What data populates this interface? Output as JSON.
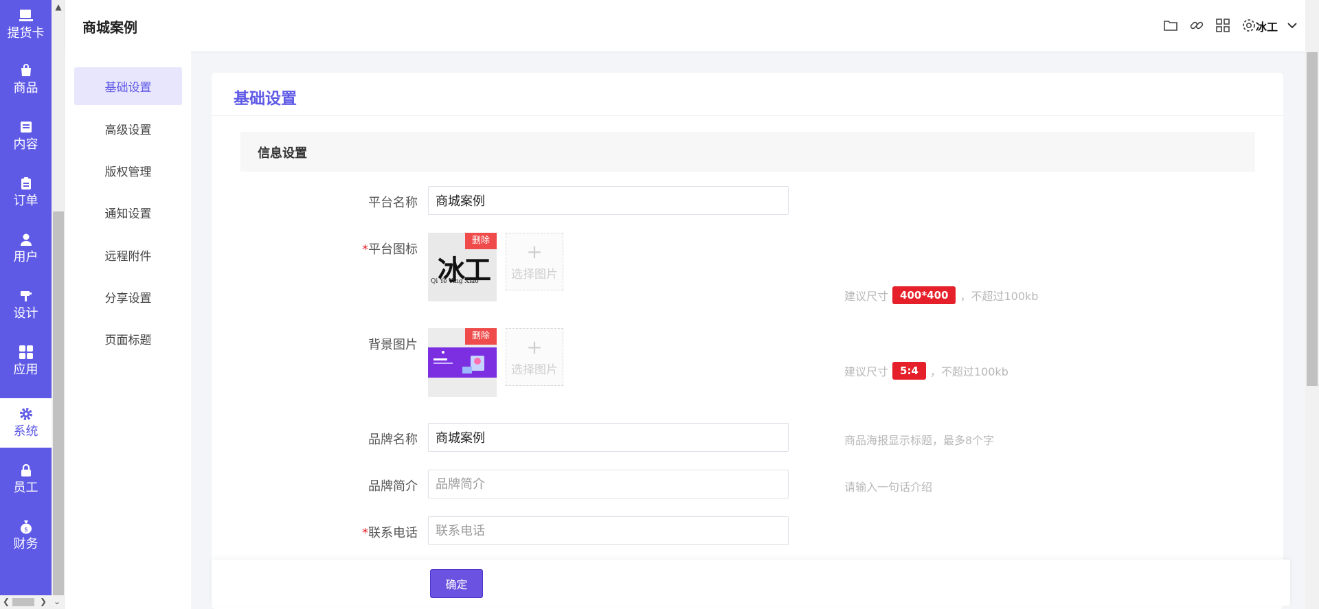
{
  "rail": {
    "items": [
      {
        "label": "提货卡",
        "icon": "card-icon"
      },
      {
        "label": "商品",
        "icon": "bag-icon"
      },
      {
        "label": "内容",
        "icon": "document-icon"
      },
      {
        "label": "订单",
        "icon": "clipboard-icon"
      },
      {
        "label": "用户",
        "icon": "user-icon"
      },
      {
        "label": "设计",
        "icon": "brush-icon"
      },
      {
        "label": "应用",
        "icon": "grid-icon"
      },
      {
        "label": "系统",
        "icon": "gear-icon"
      },
      {
        "label": "员工",
        "icon": "lock-icon"
      },
      {
        "label": "财务",
        "icon": "money-bag-icon"
      }
    ],
    "active_index": 7
  },
  "header": {
    "title": "商城案例",
    "tools": [
      "folder-icon",
      "link-icon",
      "apps-icon",
      "settings-icon"
    ],
    "logo_text": "冰工"
  },
  "subnav": {
    "items": [
      "基础设置",
      "高级设置",
      "版权管理",
      "通知设置",
      "远程附件",
      "分享设置",
      "页面标题"
    ],
    "active_index": 0
  },
  "main": {
    "card_title": "基础设置",
    "section_title": "信息设置",
    "fields": {
      "platform_name": {
        "label": "平台名称",
        "value": "商城案例",
        "required": false
      },
      "platform_icon": {
        "label": "平台图标",
        "required": true,
        "delete": "删除",
        "pick": "选择图片",
        "logo_caption": "Qi Ye Ying Xiao",
        "logo_glyph": "冰工",
        "hint_pre": "建议尺寸",
        "hint_badge": "400*400",
        "hint_post": "，不超过100kb"
      },
      "background_image": {
        "label": "背景图片",
        "required": false,
        "delete": "删除",
        "pick": "选择图片",
        "hint_pre": "建议尺寸",
        "hint_badge": "5:4",
        "hint_post": "，不超过100kb"
      },
      "brand_name": {
        "label": "品牌名称",
        "value": "商城案例",
        "hint": "商品海报显示标题，最多8个字"
      },
      "brand_intro": {
        "label": "品牌简介",
        "placeholder": "品牌简介",
        "hint": "请输入一句话介绍"
      },
      "contact_phone": {
        "label": "联系电话",
        "placeholder": "联系电话",
        "required": true
      }
    },
    "required_mark": "*",
    "submit_label": "确定"
  },
  "colors": {
    "accent": "#5f5ae6",
    "danger": "#e6202a",
    "button": "#6b52e0"
  }
}
